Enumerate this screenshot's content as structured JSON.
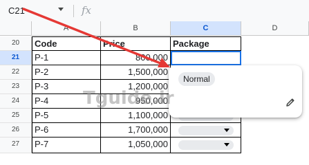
{
  "formula_bar": {
    "name_box": "C21",
    "fx_icon": "function-icon"
  },
  "columns": [
    {
      "letter": "A"
    },
    {
      "letter": "B"
    },
    {
      "letter": "C"
    },
    {
      "letter": "D"
    }
  ],
  "rows": [
    {
      "num": "20",
      "code": "Code",
      "price": "Price",
      "package": "Package"
    },
    {
      "num": "21",
      "code": "P-1",
      "price": "800,000",
      "package": ""
    },
    {
      "num": "22",
      "code": "P-2",
      "price": "1,500,000",
      "package": ""
    },
    {
      "num": "23",
      "code": "P-3",
      "price": "1,200,000",
      "package": ""
    },
    {
      "num": "24",
      "code": "P-4",
      "price": "950,000",
      "package": ""
    },
    {
      "num": "25",
      "code": "P-5",
      "price": "1,100,000",
      "package": ""
    },
    {
      "num": "26",
      "code": "P-6",
      "price": "1,700,000",
      "package": ""
    },
    {
      "num": "27",
      "code": "P-7",
      "price": "1,050,000",
      "package": ""
    }
  ],
  "dropdown": {
    "options": [
      "Normal"
    ],
    "edit_icon": "pencil-icon"
  },
  "watermark": "Tguide.ir",
  "colors": {
    "selection": "#d3e3fd",
    "active_border": "#1a73e8",
    "arrow": "#e53935",
    "chip": "#e8eaed"
  }
}
